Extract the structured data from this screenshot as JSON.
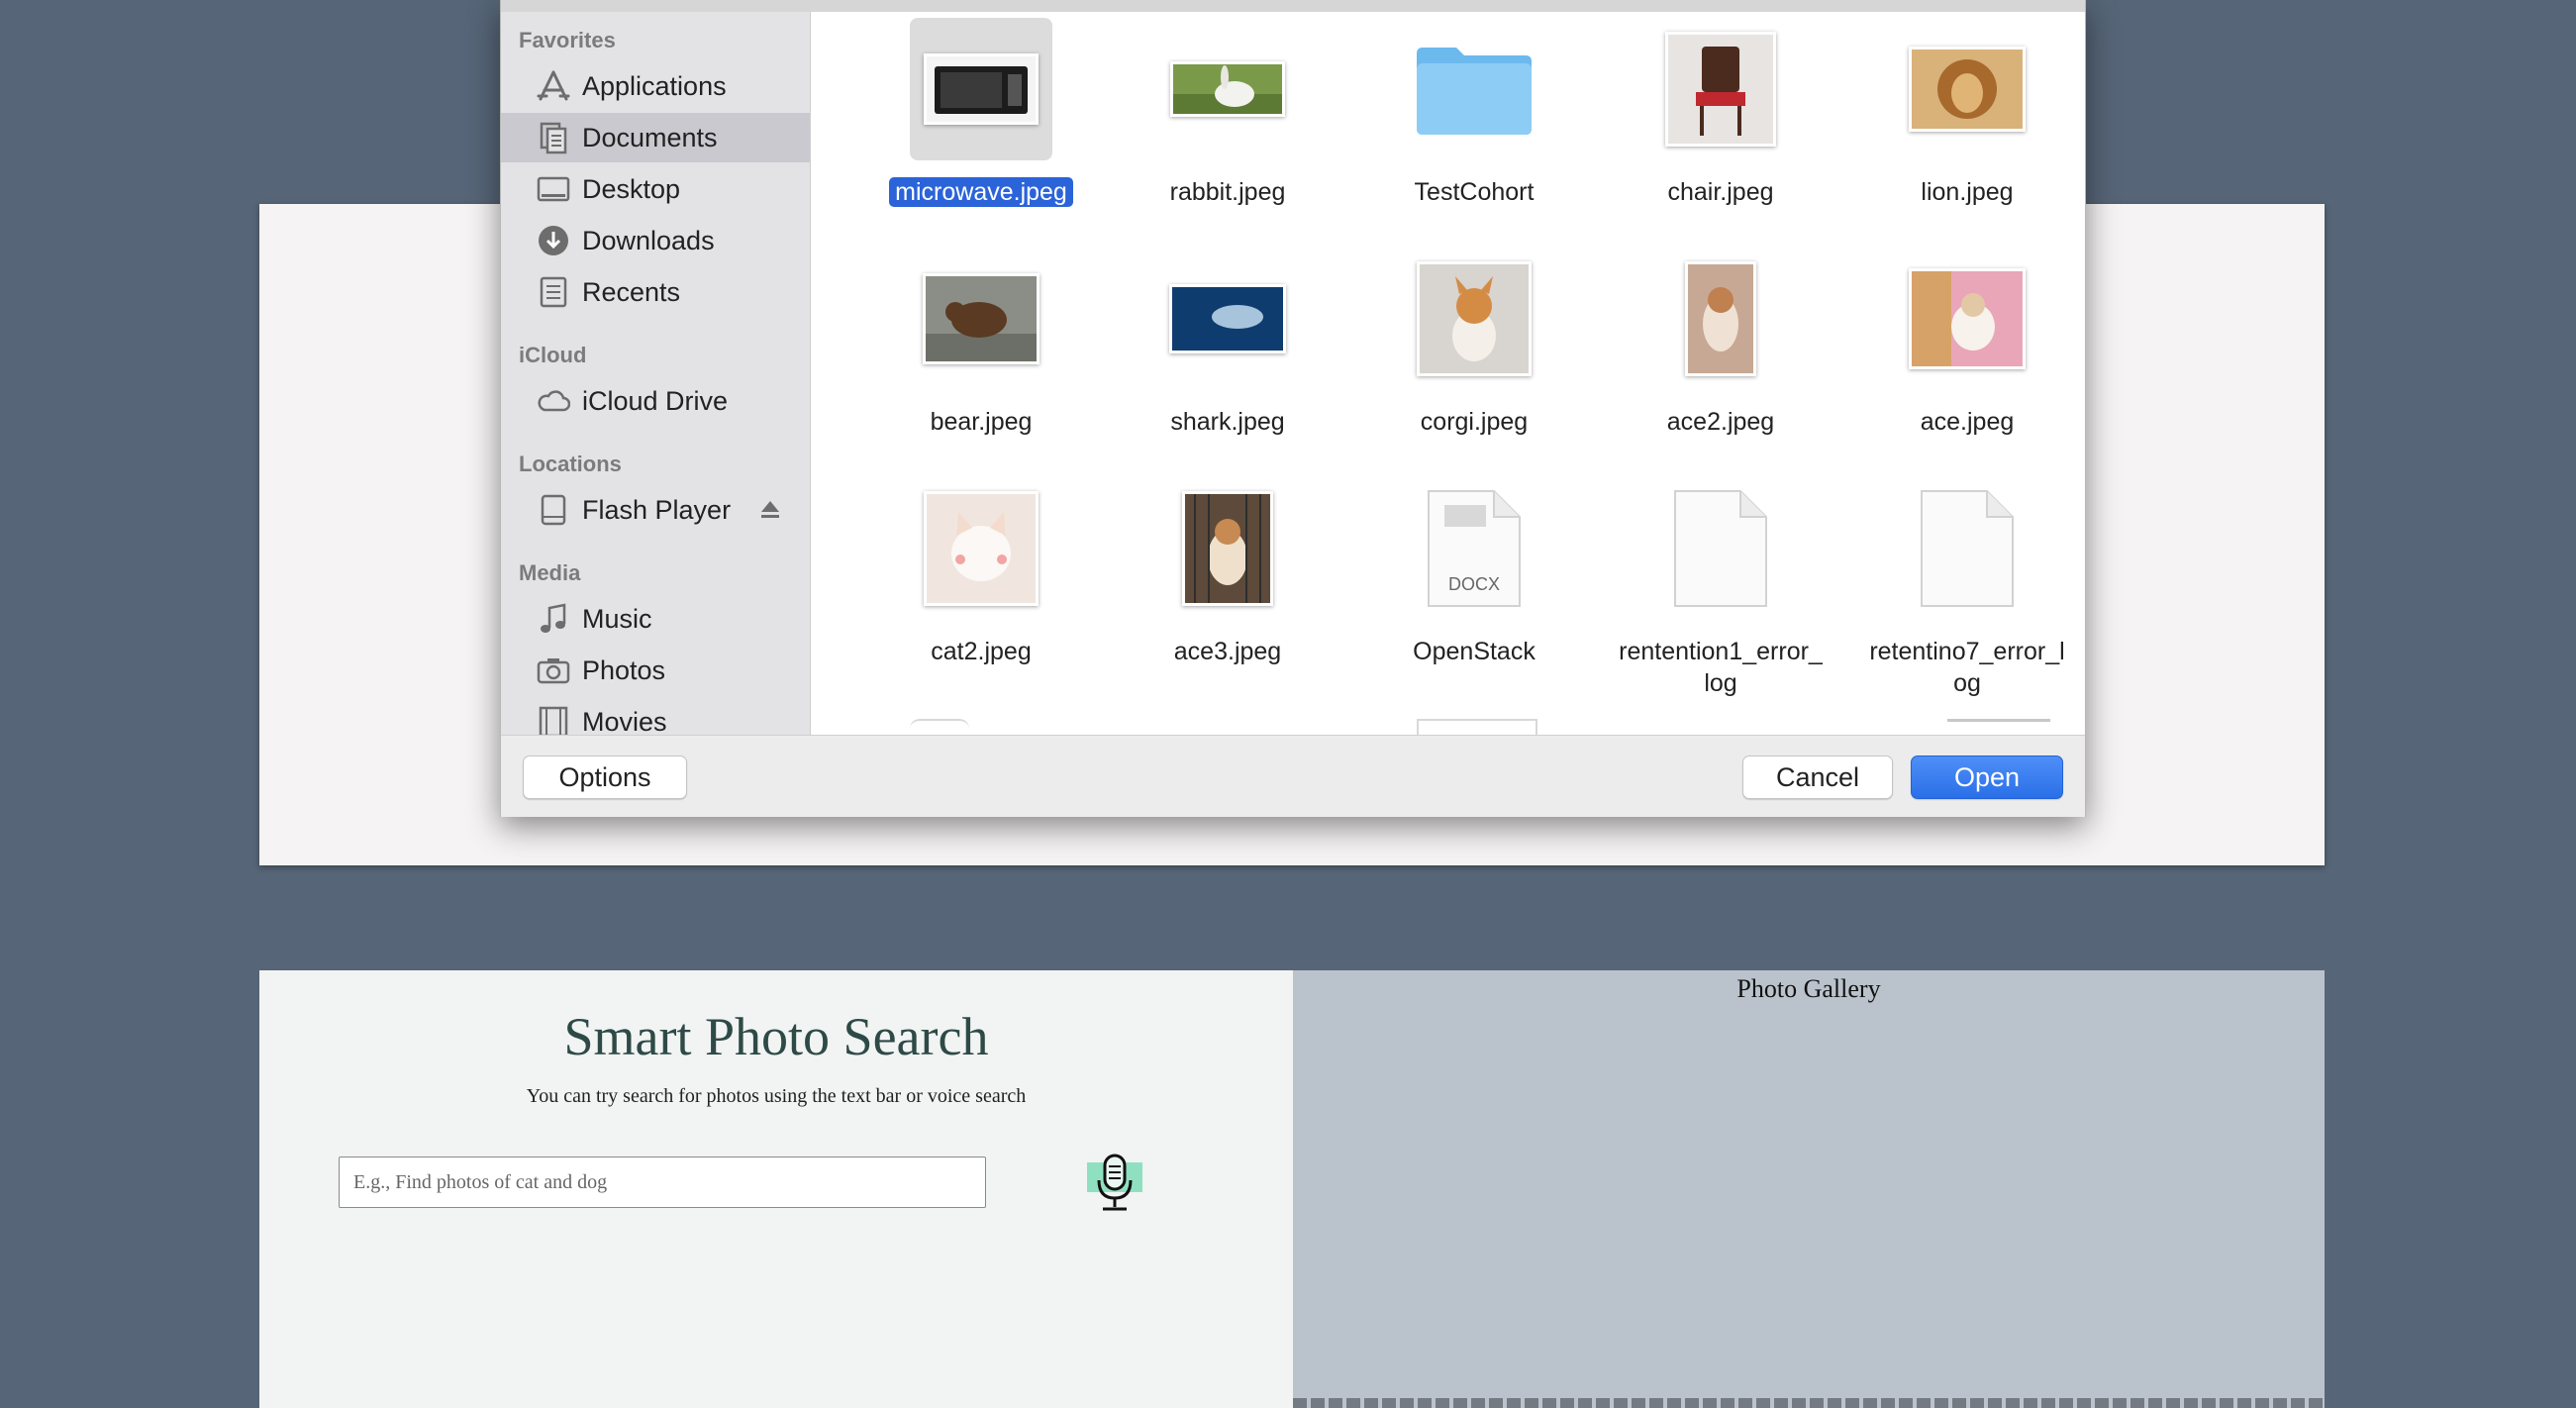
{
  "background_page": {
    "title": "Smart Photo Search",
    "subtitle": "You can try search for photos using the text bar or voice search",
    "search": {
      "placeholder": "E.g., Find photos of cat and dog",
      "value": ""
    },
    "mic_icon": "microphone-icon",
    "gallery_title": "Photo Gallery"
  },
  "dialog": {
    "sidebar": {
      "favorites_label": "Favorites",
      "favorites": [
        {
          "label": "Applications",
          "icon": "applications-icon"
        },
        {
          "label": "Documents",
          "icon": "documents-icon",
          "selected": true
        },
        {
          "label": "Desktop",
          "icon": "desktop-icon"
        },
        {
          "label": "Downloads",
          "icon": "downloads-icon"
        },
        {
          "label": "Recents",
          "icon": "recents-icon"
        }
      ],
      "icloud_label": "iCloud",
      "icloud": [
        {
          "label": "iCloud Drive",
          "icon": "cloud-icon"
        }
      ],
      "locations_label": "Locations",
      "locations": [
        {
          "label": "Flash Player",
          "icon": "disk-icon",
          "eject_icon": "eject-icon"
        }
      ],
      "media_label": "Media",
      "media": [
        {
          "label": "Music",
          "icon": "music-icon"
        },
        {
          "label": "Photos",
          "icon": "camera-icon"
        },
        {
          "label": "Movies",
          "icon": "film-icon"
        }
      ]
    },
    "files": [
      {
        "name": "microwave.jpeg",
        "kind": "image",
        "selected": true
      },
      {
        "name": "rabbit.jpeg",
        "kind": "image"
      },
      {
        "name": "TestCohort",
        "kind": "folder"
      },
      {
        "name": "chair.jpeg",
        "kind": "image"
      },
      {
        "name": "lion.jpeg",
        "kind": "image"
      },
      {
        "name": "bear.jpeg",
        "kind": "image"
      },
      {
        "name": "shark.jpeg",
        "kind": "image"
      },
      {
        "name": "corgi.jpeg",
        "kind": "image"
      },
      {
        "name": "ace2.jpeg",
        "kind": "image"
      },
      {
        "name": "ace.jpeg",
        "kind": "image"
      },
      {
        "name": "cat2.jpeg",
        "kind": "image"
      },
      {
        "name": "ace3.jpeg",
        "kind": "image"
      },
      {
        "name": "OpenStack",
        "kind": "docx",
        "badge": "DOCX"
      },
      {
        "name_line1": "rentention1_error_",
        "name_line2": "log",
        "kind": "document"
      },
      {
        "name_line1": "retentino7_error_l",
        "name_line2": "og",
        "kind": "document"
      }
    ],
    "buttons": {
      "options": "Options",
      "cancel": "Cancel",
      "open": "Open"
    },
    "colors": {
      "accent": "#2b63d9",
      "folder": "#7cc3f2"
    }
  }
}
